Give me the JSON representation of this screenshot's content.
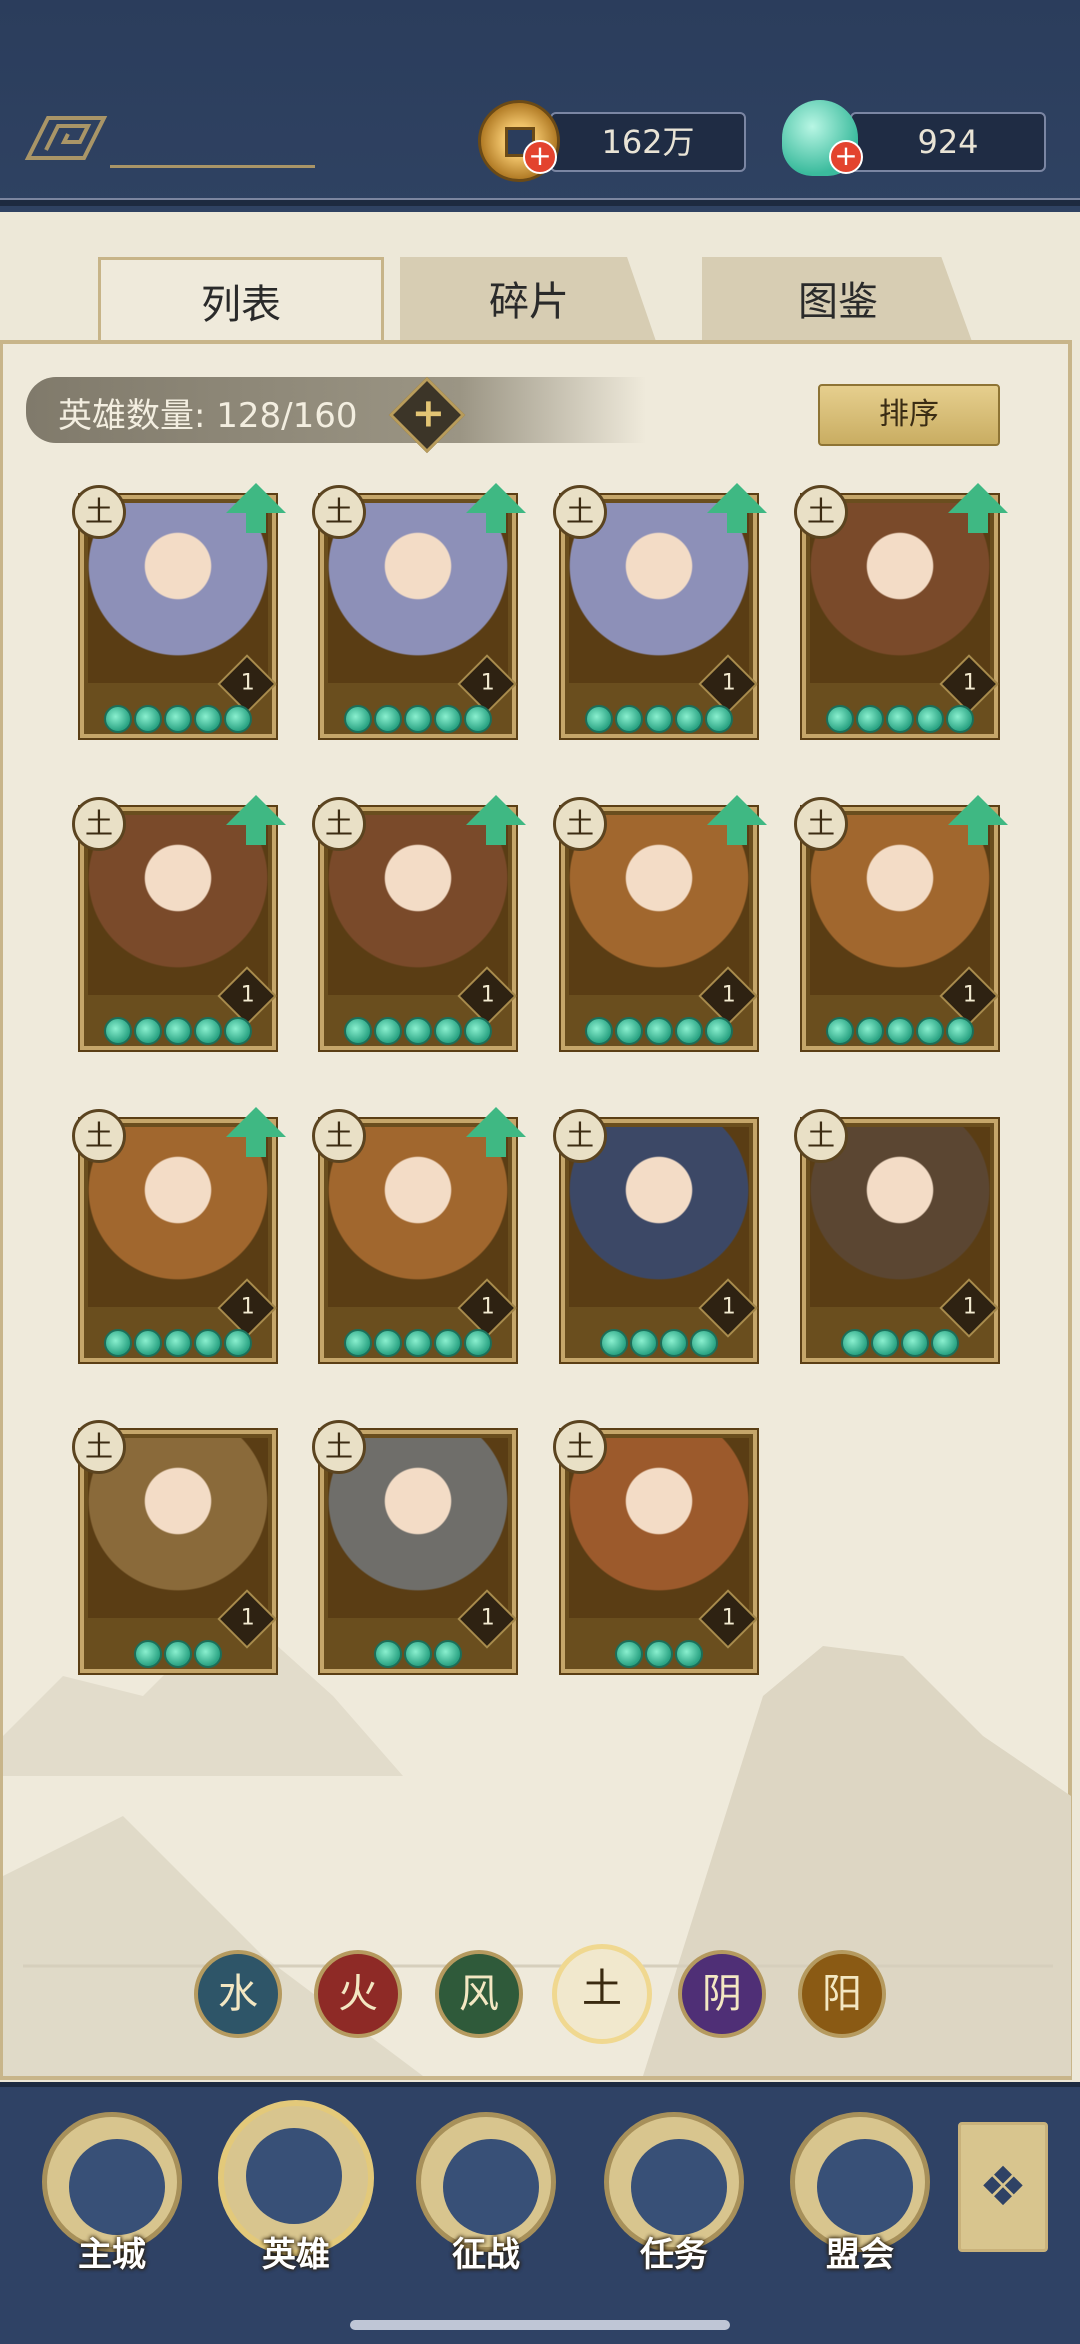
{
  "currency": {
    "copper": {
      "icon": "copper-coin-icon",
      "value": "162万"
    },
    "jade": {
      "icon": "jade-shell-icon",
      "value": "924"
    }
  },
  "tabs": [
    {
      "label": "列表",
      "active": true
    },
    {
      "label": "碎片",
      "active": false
    },
    {
      "label": "图鉴",
      "active": false
    }
  ],
  "hero_count_label": "英雄数量: 128/160",
  "sort_label": "排序",
  "heroes": [
    {
      "element": "土",
      "level": "1",
      "stars": 5,
      "can_upgrade": true
    },
    {
      "element": "土",
      "level": "1",
      "stars": 5,
      "can_upgrade": true
    },
    {
      "element": "土",
      "level": "1",
      "stars": 5,
      "can_upgrade": true
    },
    {
      "element": "土",
      "level": "1",
      "stars": 5,
      "can_upgrade": true
    },
    {
      "element": "土",
      "level": "1",
      "stars": 5,
      "can_upgrade": true
    },
    {
      "element": "土",
      "level": "1",
      "stars": 5,
      "can_upgrade": true
    },
    {
      "element": "土",
      "level": "1",
      "stars": 5,
      "can_upgrade": true
    },
    {
      "element": "土",
      "level": "1",
      "stars": 5,
      "can_upgrade": true
    },
    {
      "element": "土",
      "level": "1",
      "stars": 5,
      "can_upgrade": true
    },
    {
      "element": "土",
      "level": "1",
      "stars": 5,
      "can_upgrade": true
    },
    {
      "element": "土",
      "level": "1",
      "stars": 4,
      "can_upgrade": false
    },
    {
      "element": "土",
      "level": "1",
      "stars": 4,
      "can_upgrade": false
    },
    {
      "element": "土",
      "level": "1",
      "stars": 3,
      "can_upgrade": false
    },
    {
      "element": "土",
      "level": "1",
      "stars": 3,
      "can_upgrade": false
    },
    {
      "element": "土",
      "level": "1",
      "stars": 3,
      "can_upgrade": false
    }
  ],
  "element_filters": [
    {
      "glyph": "水",
      "color": "#2e5568",
      "selected": false
    },
    {
      "glyph": "火",
      "color": "#8e2a26",
      "selected": false
    },
    {
      "glyph": "风",
      "color": "#2f5a3a",
      "selected": false
    },
    {
      "glyph": "土",
      "color": "#f1e8cd",
      "selected": true
    },
    {
      "glyph": "阴",
      "color": "#4f2f76",
      "selected": false
    },
    {
      "glyph": "阳",
      "color": "#8a5a14",
      "selected": false
    }
  ],
  "nav": [
    {
      "label": "主城",
      "icon": "city-gate-icon",
      "selected": false
    },
    {
      "label": "英雄",
      "icon": "hero-portrait-icon",
      "selected": true
    },
    {
      "label": "征战",
      "icon": "war-drum-icon",
      "selected": false
    },
    {
      "label": "任务",
      "icon": "scroll-task-icon",
      "selected": false
    },
    {
      "label": "盟会",
      "icon": "alliance-pavilion-icon",
      "selected": false
    }
  ],
  "more_icon": "lattice-menu-icon"
}
